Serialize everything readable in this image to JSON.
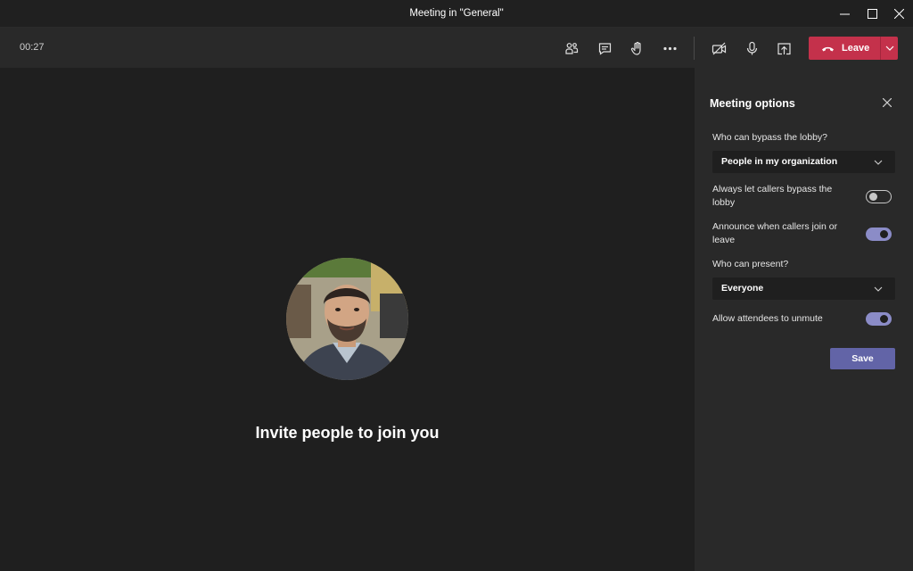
{
  "window": {
    "title": "Meeting in \"General\""
  },
  "toolbar": {
    "timer": "00:27",
    "icons": [
      "participants-icon",
      "chat-icon",
      "raise-hand-icon",
      "more-icon",
      "camera-off-icon",
      "microphone-icon",
      "share-screen-icon"
    ],
    "leave_label": "Leave",
    "leave_color": "#c4314b"
  },
  "stage": {
    "invite_text": "Invite people to join you"
  },
  "meeting_options": {
    "title": "Meeting options",
    "lobby_label": "Who can bypass the lobby?",
    "lobby_value": "People in my organization",
    "callers_bypass_label": "Always let callers bypass the lobby",
    "callers_bypass_on": false,
    "announce_label": "Announce when callers join or leave",
    "announce_on": true,
    "present_label": "Who can present?",
    "present_value": "Everyone",
    "unmute_label": "Allow attendees to unmute",
    "unmute_on": true,
    "save_label": "Save",
    "accent_color": "#6264a7"
  }
}
